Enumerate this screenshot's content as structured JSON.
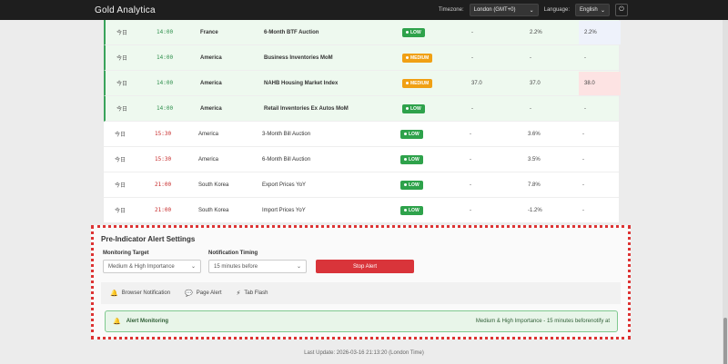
{
  "header": {
    "brand": "Gold Analytica",
    "timezone_label": "Timezone:",
    "timezone_value": "London (GMT+0)",
    "language_label": "Language:",
    "language_value": "English",
    "power_icon": "power-icon"
  },
  "events": [
    {
      "day": "今日",
      "time": "14:00",
      "country": "France",
      "indicator": "6-Month BTF Auction",
      "importance": "LOW",
      "prev": "-",
      "forecast": "2.2%",
      "actual": "2.2%",
      "highlight": true,
      "actual_bg": "#eef2fb"
    },
    {
      "day": "今日",
      "time": "14:00",
      "country": "America",
      "indicator": "Business Inventories MoM",
      "importance": "MEDIUM",
      "prev": "-",
      "forecast": "-",
      "actual": "-",
      "highlight": true,
      "actual_bg": ""
    },
    {
      "day": "今日",
      "time": "14:00",
      "country": "America",
      "indicator": "NAHB Housing Market Index",
      "importance": "MEDIUM",
      "prev": "37.0",
      "forecast": "37.0",
      "actual": "38.0",
      "highlight": true,
      "actual_bg": "#fde3e3"
    },
    {
      "day": "今日",
      "time": "14:00",
      "country": "America",
      "indicator": "Retail Inventories Ex Autos MoM",
      "importance": "LOW",
      "prev": "-",
      "forecast": "-",
      "actual": "-",
      "highlight": true,
      "actual_bg": ""
    },
    {
      "day": "今日",
      "time": "15:30",
      "country": "America",
      "indicator": "3-Month Bill Auction",
      "importance": "LOW",
      "prev": "-",
      "forecast": "3.6%",
      "actual": "-",
      "highlight": false,
      "actual_bg": ""
    },
    {
      "day": "今日",
      "time": "15:30",
      "country": "America",
      "indicator": "6-Month Bill Auction",
      "importance": "LOW",
      "prev": "-",
      "forecast": "3.5%",
      "actual": "-",
      "highlight": false,
      "actual_bg": ""
    },
    {
      "day": "今日",
      "time": "21:00",
      "country": "South Korea",
      "indicator": "Export Prices YoY",
      "importance": "LOW",
      "prev": "-",
      "forecast": "7.8%",
      "actual": "-",
      "highlight": false,
      "actual_bg": ""
    },
    {
      "day": "今日",
      "time": "21:00",
      "country": "South Korea",
      "indicator": "Import Prices YoY",
      "importance": "LOW",
      "prev": "-",
      "forecast": "-1.2%",
      "actual": "-",
      "highlight": false,
      "actual_bg": ""
    }
  ],
  "alert": {
    "title": "Pre-Indicator Alert Settings",
    "monitoring_label": "Monitoring Target",
    "monitoring_value": "Medium & High Importance",
    "timing_label": "Notification Timing",
    "timing_value": "15 minutes before",
    "stop_label": "Stop Alert",
    "opt_browser": "Browser Notification",
    "opt_page": "Page Alert",
    "opt_tab": "Tab Flash",
    "monitor_label": "Alert Monitoring",
    "monitor_status": "Medium & High Importance - 15 minutes beforenotify at"
  },
  "footer": {
    "last_update": "Last Update: 2026-03-16 21:13:20 (London Time)"
  },
  "colors": {
    "low": "#2ea24b",
    "medium": "#f0a014",
    "stop": "#d9343a",
    "highlight_border": "#3aa35b"
  }
}
